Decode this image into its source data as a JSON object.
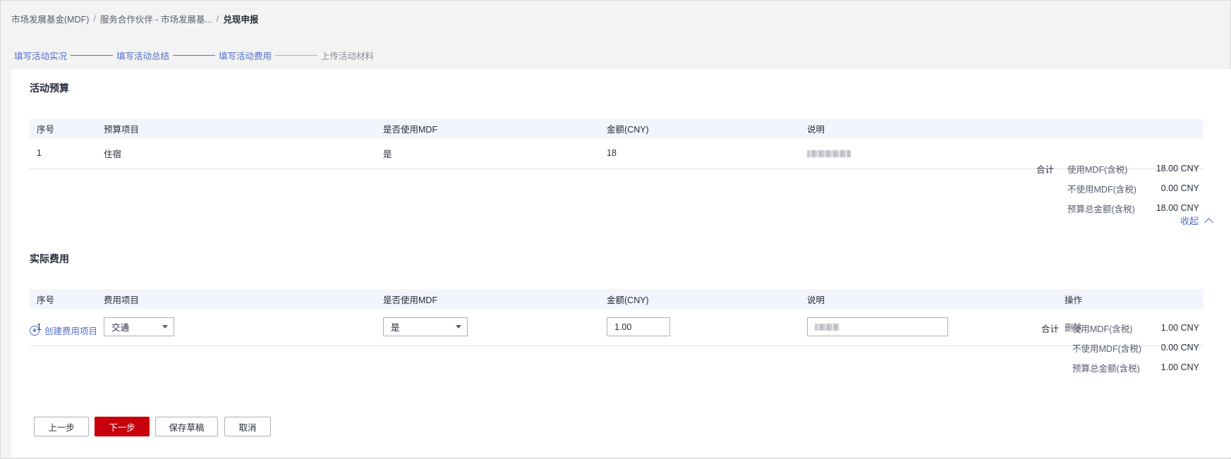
{
  "breadcrumb": [
    "市场发展基金(MDF)",
    "服务合作伙伴 - 市场发展基...",
    "兑现申报"
  ],
  "steps": [
    "填写活动实况",
    "填写活动总结",
    "填写活动费用",
    "上传活动材料"
  ],
  "budget": {
    "title": "活动预算",
    "columns": [
      "序号",
      "预算项目",
      "是否使用MDF",
      "金额(CNY)",
      "说明"
    ],
    "rows": [
      [
        "1",
        "住宿",
        "是",
        "18"
      ]
    ],
    "summary": {
      "total_label": "合计",
      "items": [
        {
          "label": "使用MDF(含税)",
          "value": "18.00 CNY"
        },
        {
          "label": "不使用MDF(含税)",
          "value": "0.00 CNY"
        },
        {
          "label": "预算总金额(含税)",
          "value": "18.00 CNY"
        }
      ]
    },
    "collapse_label": "收起"
  },
  "actual": {
    "title": "实际费用",
    "columns": [
      "序号",
      "费用项目",
      "是否使用MDF",
      "金额(CNY)",
      "说明",
      "操作"
    ],
    "row": {
      "index": "1",
      "cost_item": "交通",
      "use_mdf": "是",
      "amount": "1.00",
      "operation": "删除"
    },
    "create_label": "创建费用项目",
    "summary": {
      "total_label": "合计",
      "items": [
        {
          "label": "使用MDF(含税)",
          "value": "1.00 CNY"
        },
        {
          "label": "不使用MDF(含税)",
          "value": "0.00 CNY"
        },
        {
          "label": "预算总金额(含税)",
          "value": "1.00 CNY"
        }
      ]
    }
  },
  "buttons": {
    "prev": "上一步",
    "next": "下一步",
    "save": "保存草稿",
    "cancel": "取消"
  },
  "colors": {
    "accent": "#526ecc",
    "primary_button": "#c7000b",
    "table_header": "#f2f5fc"
  }
}
